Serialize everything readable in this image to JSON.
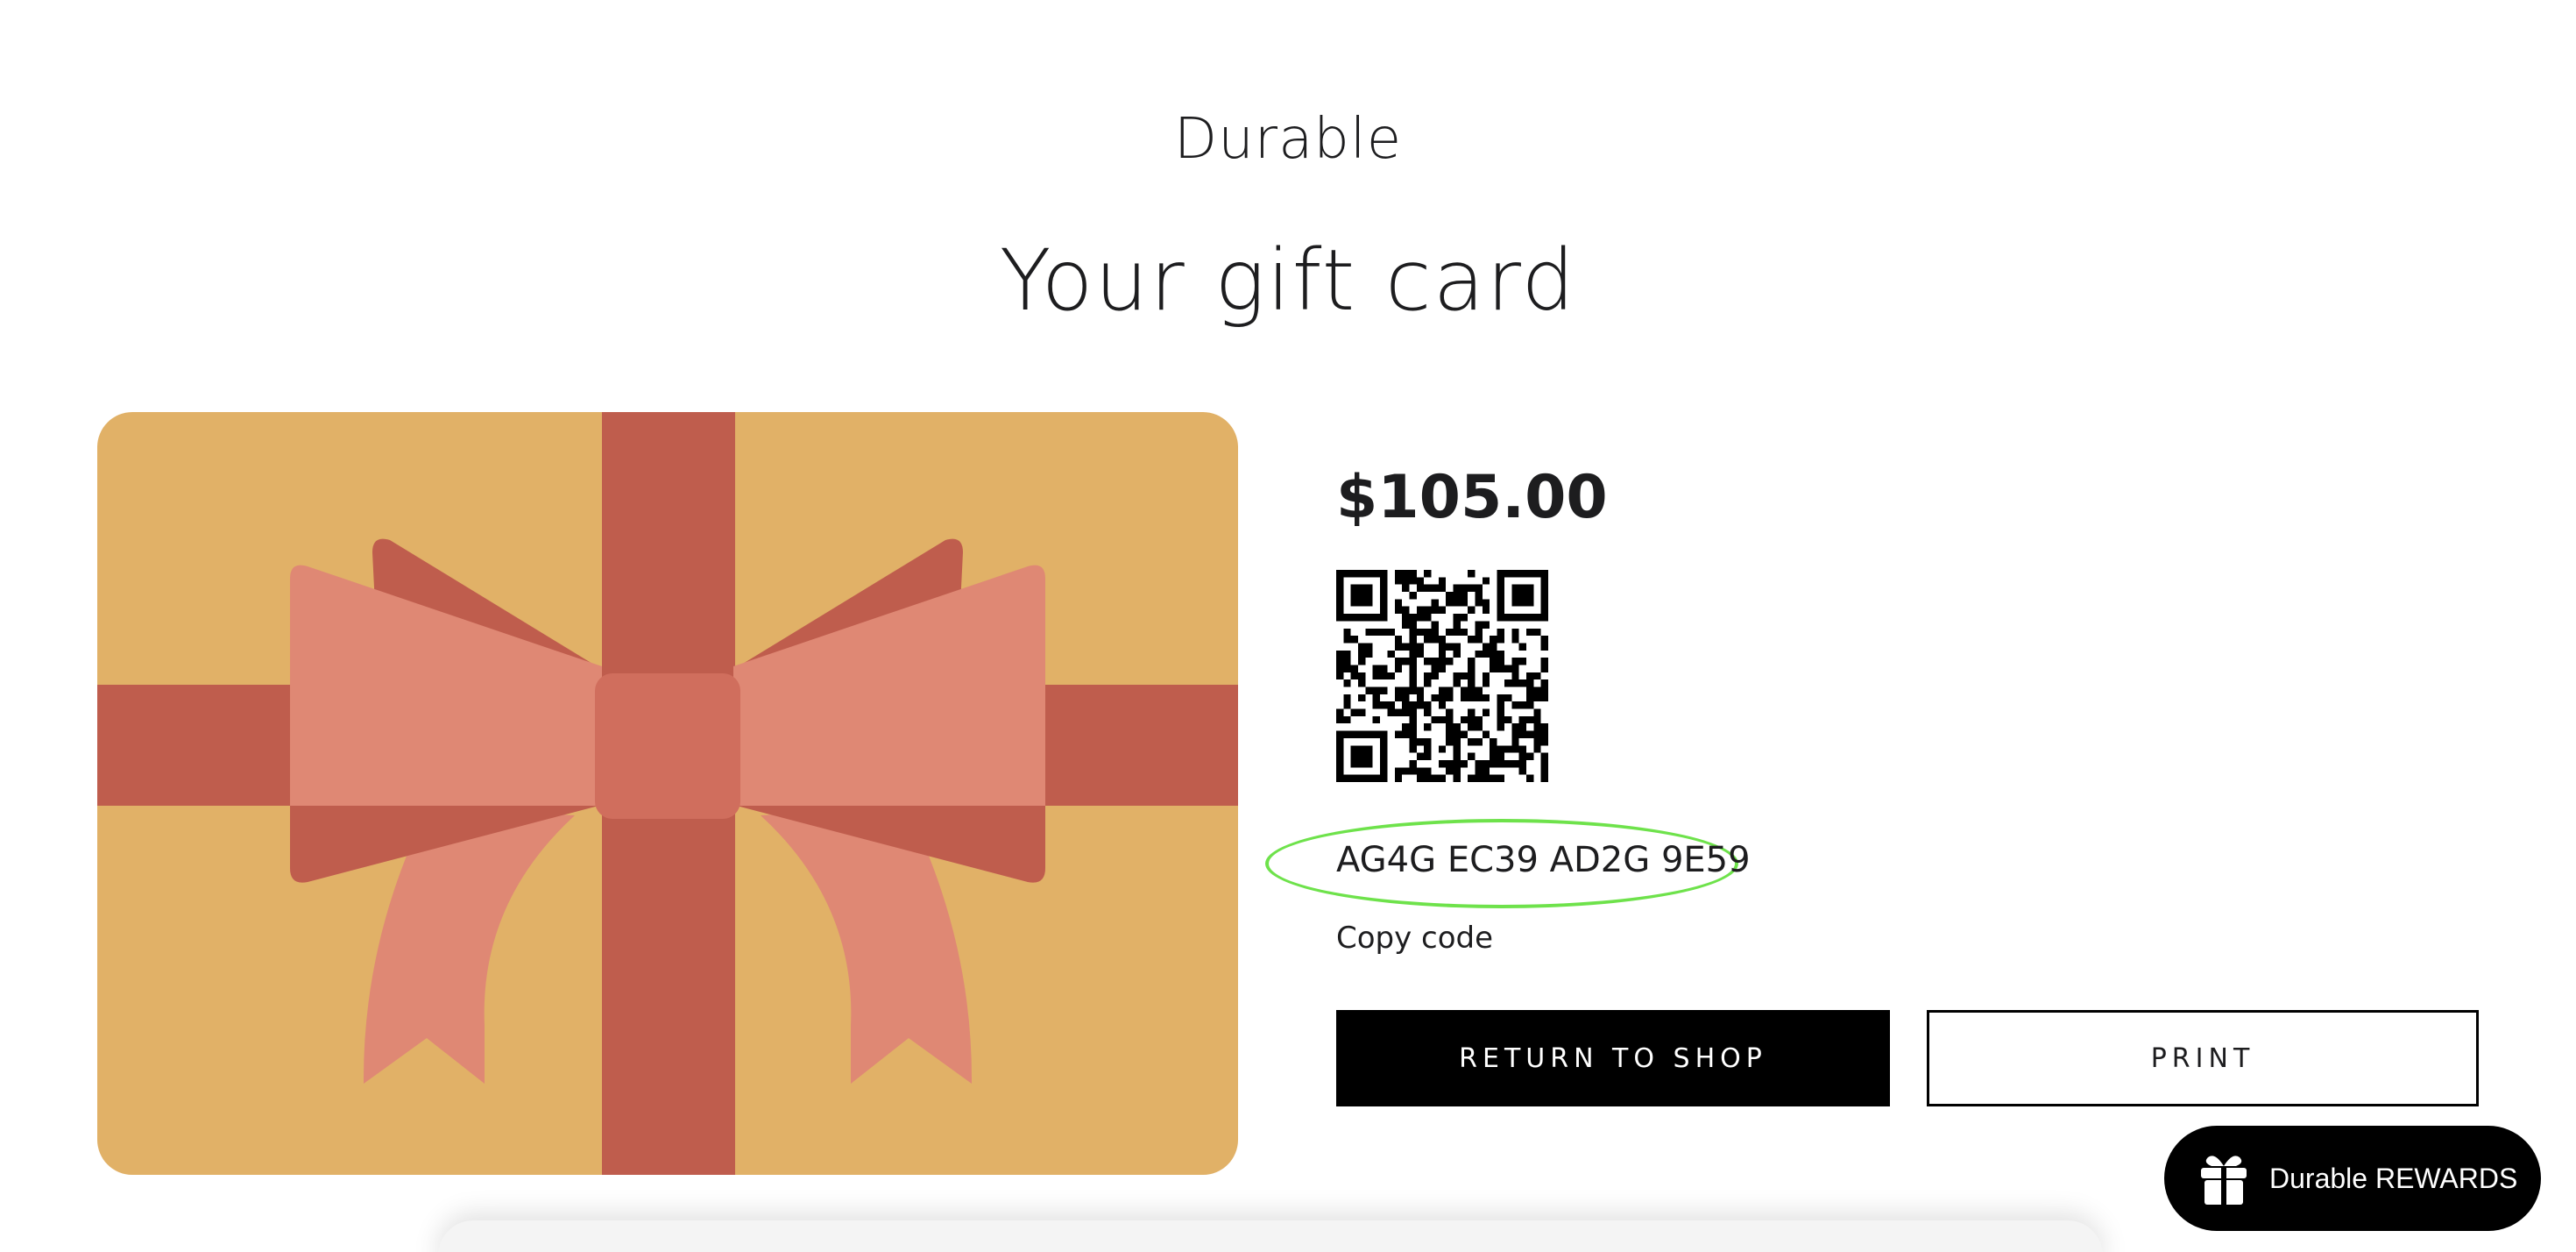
{
  "header": {
    "brand": "Durable",
    "title": "Your gift card"
  },
  "gift_card": {
    "amount": "$105.00",
    "code": "AG4G EC39 AD2G 9E59",
    "copy_label": "Copy code",
    "colors": {
      "card": "#e1b167",
      "ribbon": "#bf5d4d",
      "bow": "#df8874",
      "knot": "#d06e5d",
      "highlight": "#6ee24b"
    }
  },
  "actions": {
    "return_label": "RETURN TO SHOP",
    "print_label": "PRINT"
  },
  "rewards": {
    "label": "Durable REWARDS",
    "icon": "gift-icon"
  }
}
